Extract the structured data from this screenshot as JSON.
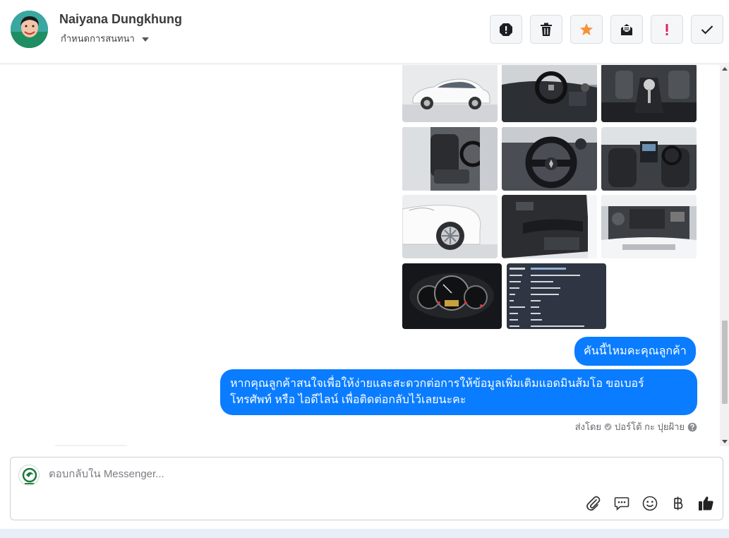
{
  "contact": {
    "name": "Naiyana Dungkhung",
    "assign_label": "กำหนดการสนทนา"
  },
  "toolbar": {
    "buttons": [
      {
        "name": "spam-report",
        "icon": "alert-octagon-icon"
      },
      {
        "name": "delete",
        "icon": "trash-icon"
      },
      {
        "name": "star",
        "icon": "star-icon",
        "color": "#f7923a"
      },
      {
        "name": "mark-unread",
        "icon": "envelope-open-icon"
      },
      {
        "name": "mark-important",
        "icon": "exclamation-icon",
        "color": "#e0245e"
      },
      {
        "name": "mark-done",
        "icon": "check-icon"
      }
    ]
  },
  "photos": [
    {
      "subject": "car-exterior-side"
    },
    {
      "subject": "car-dashboard"
    },
    {
      "subject": "car-gear-shift"
    },
    {
      "subject": "car-front-seats"
    },
    {
      "subject": "car-steering-wheel"
    },
    {
      "subject": "car-interior-rear-view"
    },
    {
      "subject": "car-front-wheel"
    },
    {
      "subject": "car-door-panel"
    },
    {
      "subject": "car-engine-bay"
    },
    {
      "subject": "car-instrument-cluster"
    },
    {
      "subject": "car-spec-sheet"
    }
  ],
  "messages": [
    {
      "text": "คันนี้ไหมคะคุณลูกค้า"
    },
    {
      "line1": "หากคุณลูกค้าสนใจเพื่อให้ง่ายและสะดวกต่อการให้ข้อมูลเพิ่มเติมแอดมินส้มโอ ขอเบอร์",
      "line2": "โทรศัพท์ หรือ ไอดีไลน์ เพื่อติดต่อกลับไว้เลยนะคะ"
    }
  ],
  "sent_by": {
    "prefix": "ส่งโดย",
    "author": "ปอร์โต้ กะ ปุยฝ้าย"
  },
  "composer": {
    "placeholder": "ตอบกลับใน Messenger..."
  },
  "composer_tools": [
    "paperclip-icon",
    "saved-reply-icon",
    "emoji-icon",
    "baht-payment-icon",
    "thumbs-up-icon"
  ],
  "colors": {
    "bubble": "#0a7cff",
    "accent_orange": "#f7923a",
    "accent_red": "#e0245e"
  }
}
